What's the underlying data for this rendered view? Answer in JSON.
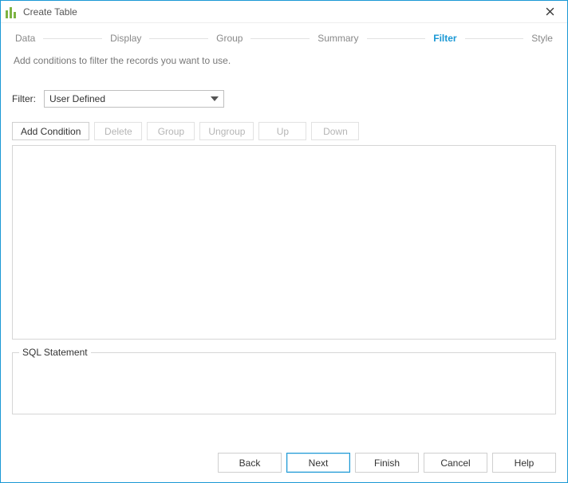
{
  "window": {
    "title": "Create Table"
  },
  "steps": {
    "data": "Data",
    "display": "Display",
    "group": "Group",
    "summary": "Summary",
    "filter": "Filter",
    "style": "Style",
    "active": "filter"
  },
  "subtitle": "Add conditions to filter the records you want to use.",
  "filter": {
    "label": "Filter:",
    "value": "User Defined"
  },
  "toolbar": {
    "add_condition": "Add Condition",
    "delete": "Delete",
    "group": "Group",
    "ungroup": "Ungroup",
    "up": "Up",
    "down": "Down"
  },
  "sql": {
    "label": "SQL Statement",
    "value": ""
  },
  "footer": {
    "back": "Back",
    "next": "Next",
    "finish": "Finish",
    "cancel": "Cancel",
    "help": "Help"
  }
}
